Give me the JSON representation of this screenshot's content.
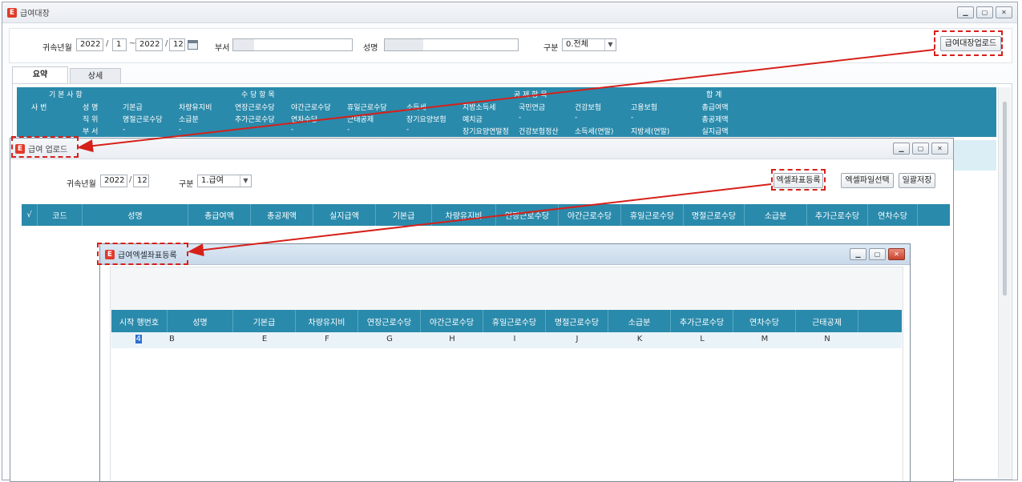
{
  "main_window": {
    "title": "급여대장",
    "filters": {
      "period_label": "귀속년월",
      "from_year": "2022",
      "from_month": "1",
      "range_sep": "~",
      "to_year": "2022",
      "to_month": "12",
      "dept_label": "부서",
      "name_label": "성명",
      "type_label": "구분",
      "type_value": "0.전체"
    },
    "upload_button": "급여대장업로드",
    "tabs": [
      "요약",
      "상세"
    ],
    "grid": {
      "group_headers": [
        "기 본 사 항",
        "수 당 항 목",
        "공 제 항 목",
        "합 계"
      ],
      "emp_no_label": "사 번",
      "basic_labels": [
        "성 명",
        "직 위",
        "부 서"
      ],
      "row1": [
        "기본급",
        "차량유지비",
        "연장근로수당",
        "야간근로수당",
        "휴일근로수당",
        "소득세",
        "지방소득세",
        "국민연금",
        "건강보험",
        "고용보험",
        "총급여액"
      ],
      "row2": [
        "명절근로수당",
        "소급분",
        "추가근로수당",
        "연차수당",
        "근태공제",
        "장기요양보험",
        "예치금",
        "-",
        "-",
        "-",
        "총공제액"
      ],
      "row3": [
        "-",
        "-",
        "-",
        "-",
        "-",
        "-",
        "장기요양연말정",
        "건강보험정산",
        "소득세(연말)",
        "지방세(연말)",
        "실지급액"
      ]
    }
  },
  "upload_window": {
    "title": "급여 업로드",
    "period_label": "귀속년월",
    "year": "2022",
    "month": "12",
    "type_label": "구분",
    "type_value": "1.급여",
    "buttons": {
      "excel_mapping": "엑셀좌표등록",
      "excel_file": "엑셀파일선택",
      "batch_save": "일괄저장"
    },
    "columns": [
      "√",
      "코드",
      "성명",
      "총급여액",
      "총공제액",
      "실지급액",
      "기본급",
      "차량유지비",
      "연장근로수당",
      "야간근로수당",
      "휴일근로수당",
      "명절근로수당",
      "소급분",
      "추가근로수당",
      "연차수당"
    ]
  },
  "mapping_window": {
    "title": "급여엑셀좌표등록",
    "columns": [
      "시작 행번호",
      "성명",
      "기본급",
      "차량유지비",
      "연장근로수당",
      "야간근로수당",
      "휴일근로수당",
      "명절근로수당",
      "소급분",
      "추가근로수당",
      "연차수당",
      "근태공제"
    ],
    "row": [
      "4",
      "B",
      "E",
      "F",
      "G",
      "H",
      "I",
      "J",
      "K",
      "L",
      "M",
      "N"
    ]
  },
  "colors": {
    "grid_header": "#2a8aab",
    "highlight": "#d6201a",
    "arrow": "#d6201a"
  }
}
